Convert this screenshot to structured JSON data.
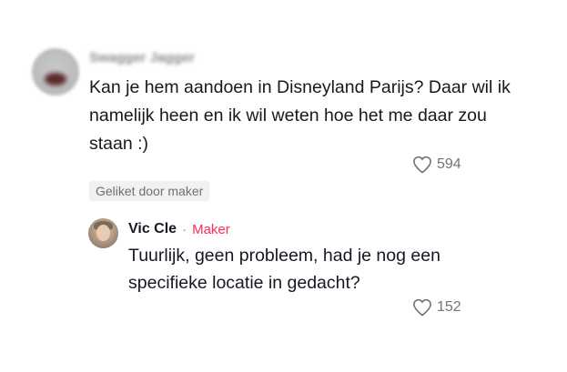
{
  "comment": {
    "username": "Swagger Jagger",
    "text": "Kan je hem aandoen in Disneyland Parijs? Daar wil ik namelijk heen en ik wil weten hoe het me daar zou staan :)",
    "likes": "594",
    "liked_by_creator_label": "Geliket door maker"
  },
  "reply": {
    "username": "Vic Cle",
    "separator": "·",
    "role": "Maker",
    "text": "Tuurlijk, geen probleem, had je nog een specifieke locatie in gedacht?",
    "likes": "152"
  },
  "colors": {
    "text": "#161823",
    "muted": "#73747b",
    "creator_accent": "#fe2c55",
    "badge_bg": "#f1f1f2"
  },
  "icons": {
    "like": "heart-outline-icon"
  }
}
